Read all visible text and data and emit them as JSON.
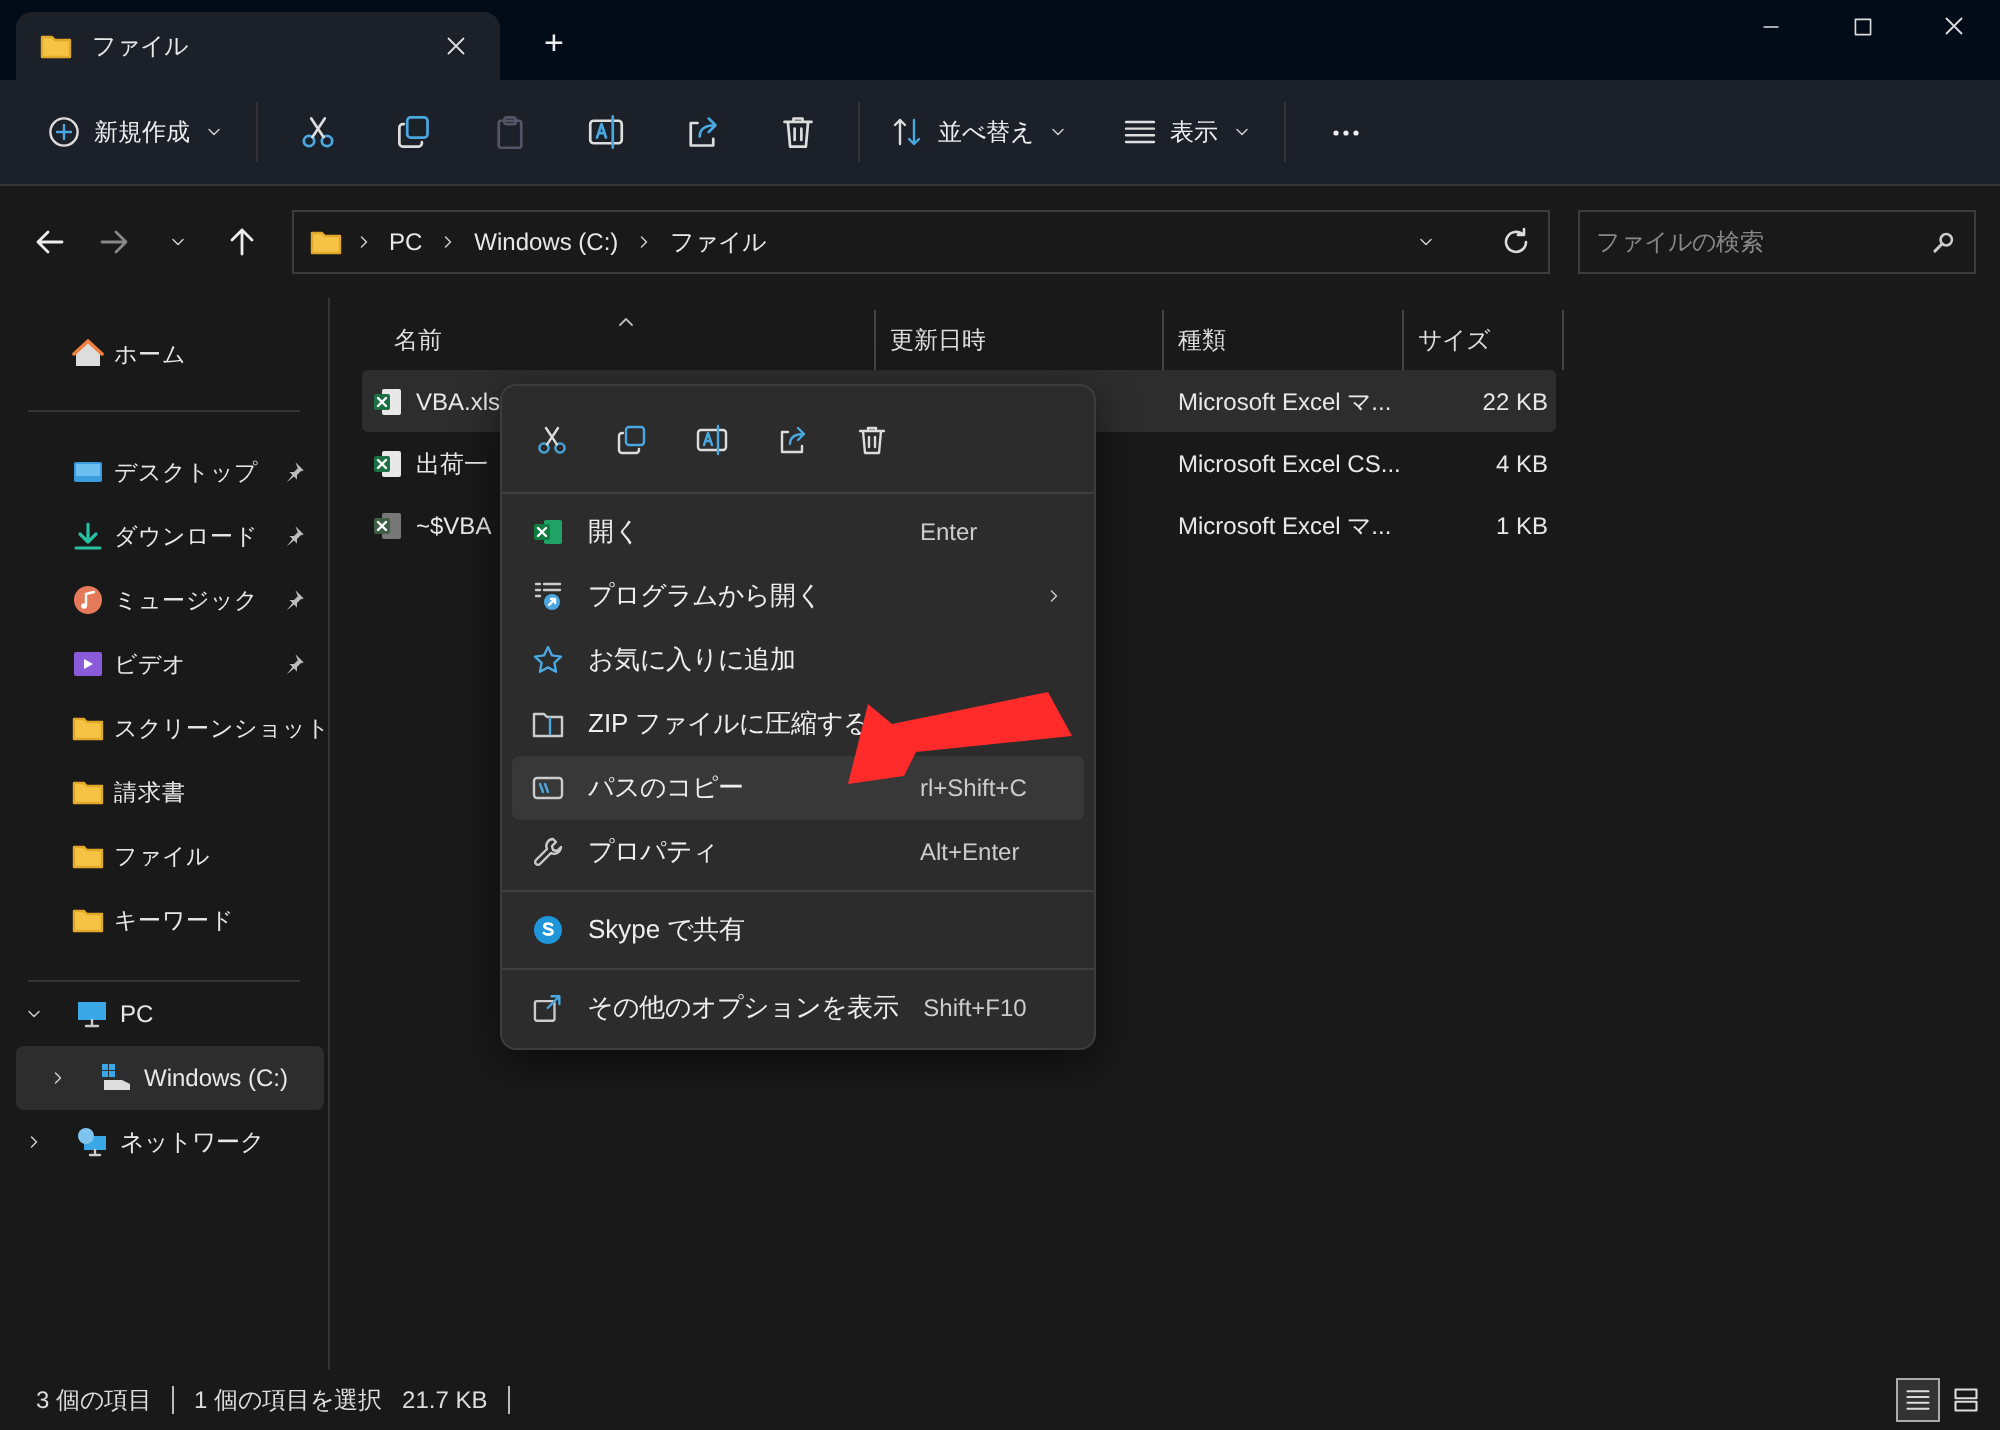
{
  "window": {
    "tab_title": "ファイル",
    "new_tab": "+"
  },
  "toolbar": {
    "new_button": "新規作成",
    "sort_button": "並べ替え",
    "view_button": "表示"
  },
  "address_bar": {
    "path": [
      "PC",
      "Windows (C:)",
      "ファイル"
    ]
  },
  "search": {
    "placeholder": "ファイルの検索"
  },
  "sidebar": {
    "home": "ホーム",
    "quick_access": [
      {
        "label": "デスクトップ",
        "kind": "desktop",
        "pinned": true
      },
      {
        "label": "ダウンロード",
        "kind": "download",
        "pinned": true
      },
      {
        "label": "ミュージック",
        "kind": "music",
        "pinned": true
      },
      {
        "label": "ビデオ",
        "kind": "video",
        "pinned": true
      },
      {
        "label": "スクリーンショット",
        "kind": "folder",
        "pinned": false
      },
      {
        "label": "請求書",
        "kind": "folder",
        "pinned": false
      },
      {
        "label": "ファイル",
        "kind": "folder",
        "pinned": false
      },
      {
        "label": "キーワード",
        "kind": "folder",
        "pinned": false
      }
    ],
    "tree": [
      {
        "label": "PC",
        "kind": "pc",
        "expanded": true,
        "selected": false,
        "children": [
          {
            "label": "Windows (C:)",
            "kind": "drive",
            "expanded": false,
            "selected": true
          }
        ]
      },
      {
        "label": "ネットワーク",
        "kind": "network",
        "expanded": false,
        "selected": false
      }
    ]
  },
  "file_list": {
    "columns": [
      "名前",
      "更新日時",
      "種類",
      "サイズ"
    ],
    "rows": [
      {
        "name": "VBA.xls",
        "type": "Microsoft Excel マ...",
        "size": "22 KB",
        "kind": "workbook",
        "selected": true
      },
      {
        "name": "出荷一",
        "type": "Microsoft Excel CS...",
        "size": "4 KB",
        "kind": "csv",
        "selected": false
      },
      {
        "name": "~$VBA",
        "type": "Microsoft Excel マ...",
        "size": "1 KB",
        "kind": "hidden",
        "selected": false
      }
    ]
  },
  "context_menu": {
    "groups": [
      [
        {
          "label": "開く",
          "shortcut": "Enter",
          "kind": "excel",
          "submenu": false,
          "selected": false
        },
        {
          "label": "プログラムから開く",
          "kind": "apps",
          "submenu": true,
          "selected": false
        },
        {
          "label": "お気に入りに追加",
          "kind": "star",
          "submenu": false,
          "selected": false
        },
        {
          "label": "ZIP ファイルに圧縮する",
          "kind": "zip",
          "submenu": false,
          "selected": false
        },
        {
          "label": "パスのコピー",
          "shortcut": "rl+Shift+C",
          "kind": "path",
          "submenu": false,
          "selected": true
        },
        {
          "label": "プロパティ",
          "shortcut": "Alt+Enter",
          "kind": "wrench",
          "submenu": false,
          "selected": false
        }
      ],
      [
        {
          "label": "Skype で共有",
          "kind": "skype",
          "submenu": false,
          "selected": false
        }
      ],
      [
        {
          "label": "その他のオプションを表示",
          "shortcut": "Shift+F10",
          "kind": "more",
          "submenu": false,
          "selected": false
        }
      ]
    ]
  },
  "status_bar": {
    "item_count": "3 個の項目",
    "selection": "1 個の項目を選択",
    "selection_size": "21.7 KB"
  },
  "view_modes": [
    {
      "kind": "details",
      "selected": true
    },
    {
      "kind": "tiles",
      "selected": false
    }
  ]
}
